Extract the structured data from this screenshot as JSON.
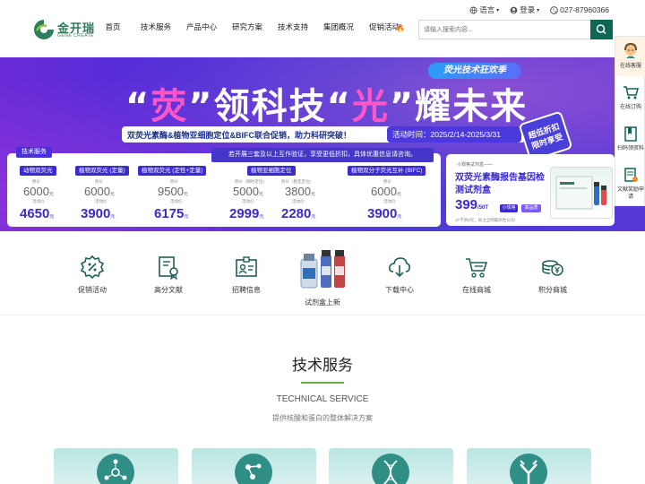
{
  "header": {
    "logo_cn": "金开瑞",
    "logo_en": "GENE CREATE",
    "nav": [
      {
        "label": "首页"
      },
      {
        "label": "技术服务"
      },
      {
        "label": "产品中心"
      },
      {
        "label": "研究方案"
      },
      {
        "label": "技术支持"
      },
      {
        "label": "集团概况"
      },
      {
        "label": "促销活动"
      }
    ],
    "language": "语言",
    "login": "登录",
    "phone": "027-87960366",
    "search_placeholder": "请输入搜索内容..."
  },
  "banner": {
    "pill": "荧光技术狂欢季",
    "headline": [
      "“",
      "荧",
      "”领科技“",
      "光",
      "”耀未来"
    ],
    "subline": "双荧光素酶&植物亚细胞定位&BIFC联合促销，助力科研突破！",
    "period": "活动时间：2025/2/14-2025/3/31",
    "stamp": [
      "超低折扣",
      "限时享受"
    ],
    "notice": "若开展三套及以上互作验证，享受更低折扣，具体优惠信息请咨询。",
    "tech_tag": "技术服务",
    "cards": [
      {
        "title": "动物双荧光",
        "orig_label": "原价",
        "orig": "6000",
        "act_label": "活动价",
        "act": "4650",
        "unit": "元"
      },
      {
        "title": "植物双荧光 (定量)",
        "orig_label": "原价",
        "orig": "6000",
        "act_label": "活动价",
        "act": "3900",
        "unit": "元"
      },
      {
        "title": "植物双荧光 (定性+定量)",
        "orig_label": "原价",
        "orig": "9500",
        "act_label": "活动价",
        "act": "6175",
        "unit": "元"
      },
      {
        "title": "植物亚细胞定位",
        "orig_label": "原价（瞬时定位）",
        "orig": "5000",
        "orig2_label": "原价（稳定定位）",
        "orig2": "3800",
        "act_label": "活动价",
        "act": "2999",
        "act2": "2280",
        "unit": "元"
      },
      {
        "title": "植物双分子荧光互补 (BIFC)",
        "orig_label": "原价",
        "orig": "6000",
        "act_label": "活动价",
        "act": "3900",
        "unit": "元"
      }
    ],
    "ad": {
      "small": "小规格试剂盒——",
      "title": "双荧光素酶报告基因检测试剂盒",
      "price": "399",
      "unit": "/50T",
      "tag1": "小规格",
      "tag2": "高品质",
      "note": "1T不到8元，助注全网最高性价比!"
    }
  },
  "side_tools": [
    {
      "label": "在线客服",
      "icon": "customer-service-icon"
    },
    {
      "label": "在线订购",
      "icon": "cart-icon"
    },
    {
      "label": "扫码领资料",
      "icon": "qr-book-icon"
    },
    {
      "label": "文献奖励申请",
      "icon": "document-reward-icon"
    }
  ],
  "quick_links": [
    {
      "label": "促销活动",
      "icon": "discount-badge-icon"
    },
    {
      "label": "高分文献",
      "icon": "document-award-icon"
    },
    {
      "label": "招聘信息",
      "icon": "id-card-icon"
    },
    {
      "label": "试剂盒上新",
      "icon": "reagent-bottles-icon"
    },
    {
      "label": "下载中心",
      "icon": "cloud-download-icon"
    },
    {
      "label": "在线商城",
      "icon": "shopping-cart-icon"
    },
    {
      "label": "积分商城",
      "icon": "coins-icon"
    }
  ],
  "tech_section": {
    "title": "技术服务",
    "en": "TECHNICAL SERVICE",
    "desc": "提供核酸和蛋白的整体解决方案"
  },
  "colors": {
    "brand_green": "#0e6655",
    "banner_purple": "#4b2fd9",
    "highlight_pink": "#ff56c8",
    "accent_line": "#6ab04c"
  }
}
